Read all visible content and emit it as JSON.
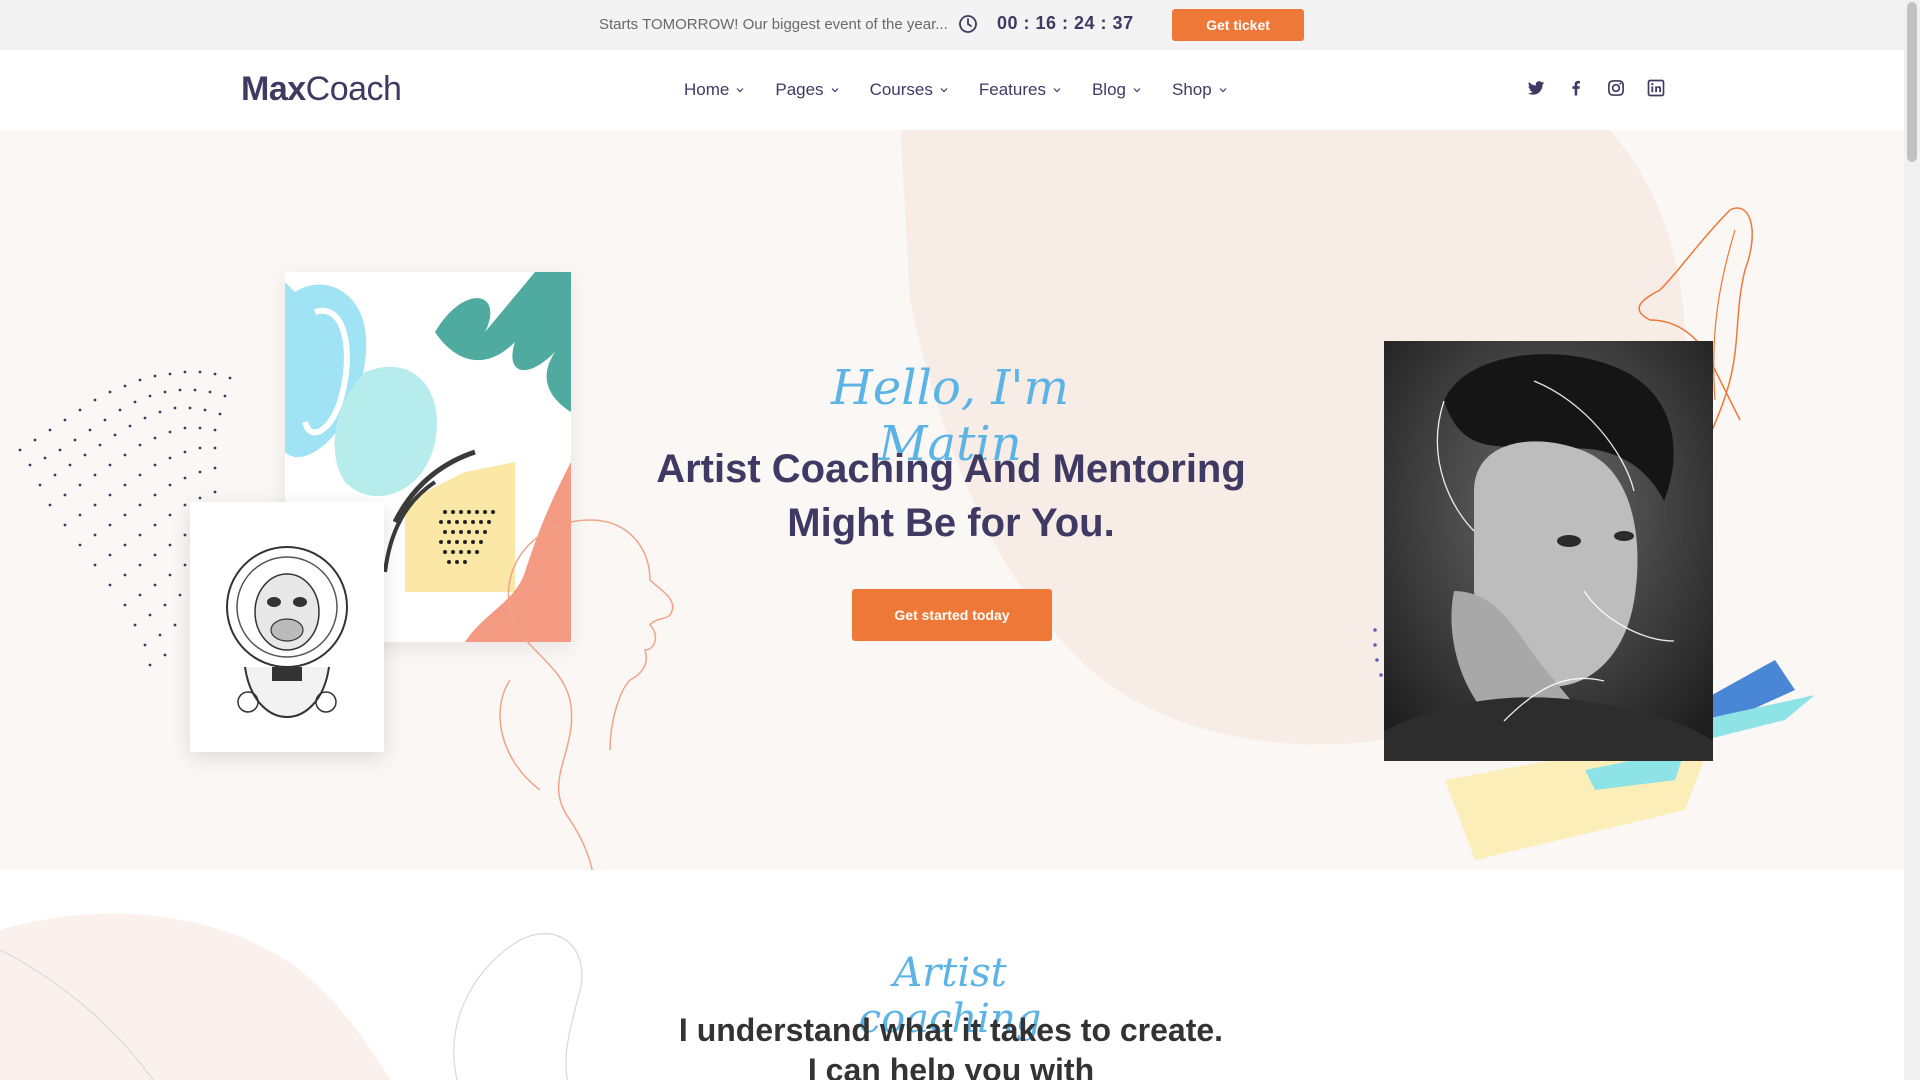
{
  "topbar": {
    "promo_text": "Starts TOMORROW! Our biggest event of the year...",
    "countdown": "00 : 16 : 24 : 37",
    "ticket_label": "Get ticket"
  },
  "header": {
    "logo_bold": "Max",
    "logo_light": "Coach",
    "nav": [
      "Home",
      "Pages",
      "Courses",
      "Features",
      "Blog",
      "Shop"
    ],
    "social_icons": [
      "twitter-icon",
      "facebook-icon",
      "instagram-icon",
      "linkedin-icon"
    ]
  },
  "hero": {
    "greeting": "Hello, I'm Matin",
    "headline_line1": "Artist Coaching And Mentoring",
    "headline_line2": "Might Be for You.",
    "cta_label": "Get started today"
  },
  "section2": {
    "subtitle": "Artist coaching",
    "headline_line1": "I understand what it takes to create.",
    "headline_line2": "I can help you with"
  },
  "colors": {
    "accent": "#ee7838",
    "heading": "#3f3a64",
    "script": "#5cb4e6",
    "hero_bg": "#faf7f4"
  }
}
